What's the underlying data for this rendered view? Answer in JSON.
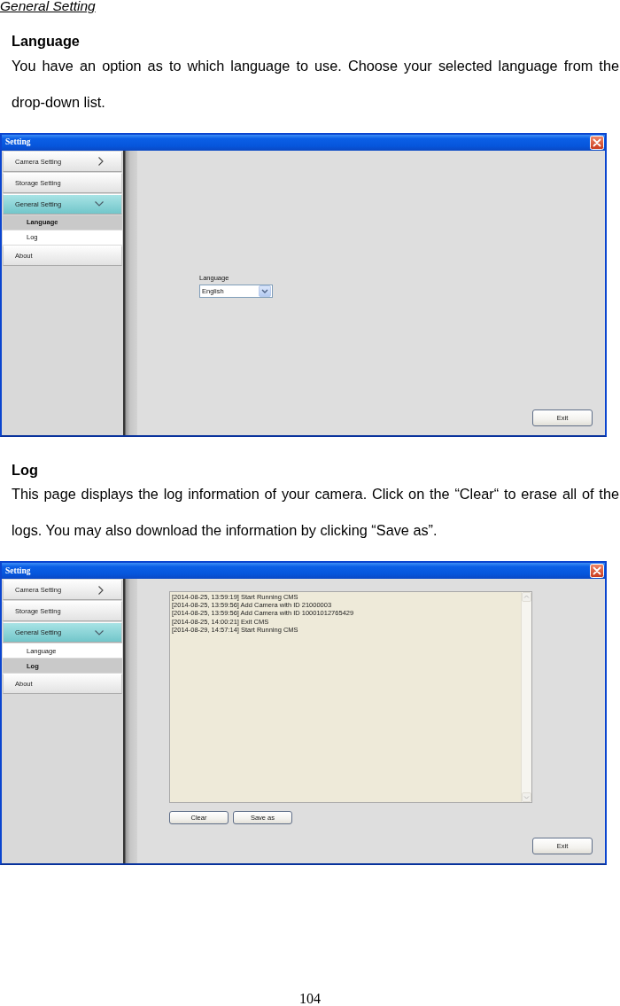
{
  "section_title": "General Setting",
  "sections": [
    {
      "heading": "Language",
      "body": "You have an option as to which language to use. Choose your selected language from the drop-down list.",
      "window": {
        "title": "Setting",
        "nav": [
          {
            "label": "Camera Setting",
            "kind": "expandable",
            "expanded": false,
            "selected": false
          },
          {
            "label": "Storage Setting",
            "kind": "plain",
            "selected": false
          },
          {
            "label": "General Setting",
            "kind": "expandable",
            "expanded": true,
            "selected": true,
            "children": [
              {
                "label": "Language",
                "selected": true
              },
              {
                "label": "Log",
                "selected": false
              }
            ]
          },
          {
            "label": "About",
            "kind": "plain",
            "selected": false
          }
        ],
        "panel": {
          "kind": "language",
          "field_label": "Language",
          "value": "English"
        },
        "exit_button": "Exit"
      }
    },
    {
      "heading": "Log",
      "body": "This page displays the log information of your camera. Click on the “Clear“ to erase all of the logs. You may also download the information by clicking “Save as”.",
      "window": {
        "title": "Setting",
        "nav": [
          {
            "label": "Camera Setting",
            "kind": "expandable",
            "expanded": false,
            "selected": false
          },
          {
            "label": "Storage Setting",
            "kind": "plain",
            "selected": false
          },
          {
            "label": "General Setting",
            "kind": "expandable",
            "expanded": true,
            "selected": true,
            "children": [
              {
                "label": "Language",
                "selected": false
              },
              {
                "label": "Log",
                "selected": true
              }
            ]
          },
          {
            "label": "About",
            "kind": "plain",
            "selected": false
          }
        ],
        "panel": {
          "kind": "log",
          "lines": [
            "[2014-08-25, 13:59:19] Start Running CMS",
            "[2014-08-25, 13:59:56] Add Camera with ID 21000003",
            "[2014-08-25, 13:59:56] Add Camera with ID 10001012765429",
            "[2014-08-25, 14:00:21] Exit CMS",
            "[2014-08-29, 14:57:14] Start Running CMS"
          ],
          "buttons": [
            "Clear",
            "Save as"
          ]
        },
        "exit_button": "Exit"
      }
    }
  ],
  "page_number": "104"
}
